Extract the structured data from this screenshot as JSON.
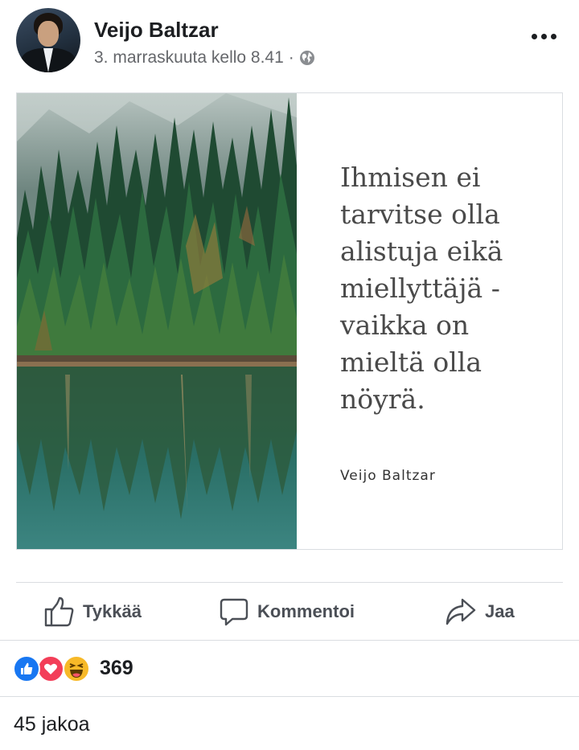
{
  "post": {
    "author": "Veijo Baltzar",
    "timestamp": "3. marraskuuta kello 8.41",
    "separator": "·",
    "audience_icon": "globe-icon",
    "menu_icon": "more-options-icon"
  },
  "image": {
    "quote_text": "Ihmisen ei\ntarvitse olla\nalistuja eikä\nmiellyttäjä -\nvaikka on\nmieltä olla\nnöyrä.",
    "quote_author": "Veijo Baltzar"
  },
  "actions": {
    "like_label": "Tykkää",
    "comment_label": "Kommentoi",
    "share_label": "Jaa"
  },
  "reactions": {
    "types": [
      "like",
      "love",
      "haha"
    ],
    "count": "369"
  },
  "shares": {
    "label": "45 jakoa"
  },
  "colors": {
    "like_blue": "#1877f2",
    "love_red": "#f33e58",
    "haha_yellow": "#f7b928",
    "text_secondary": "#65676b",
    "action_gray": "#4b4f56",
    "divider": "#dadde1"
  }
}
